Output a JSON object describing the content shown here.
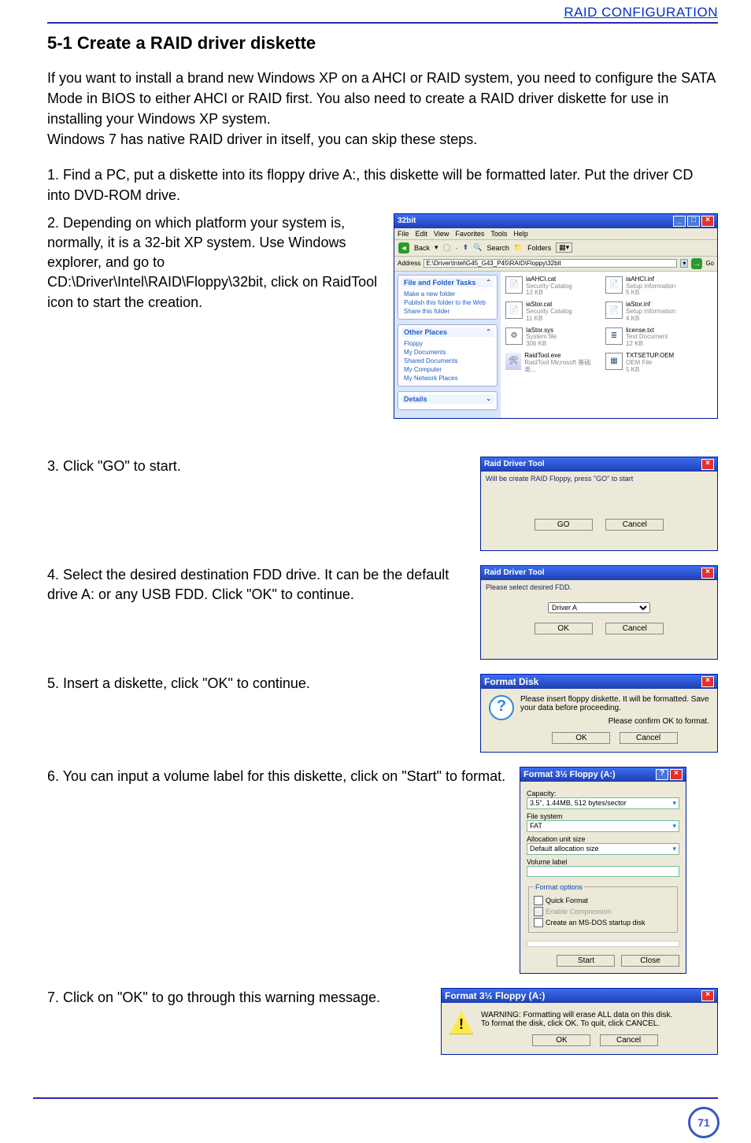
{
  "header": {
    "title": "RAID CONFIGURATION"
  },
  "section": {
    "title": "5-1 Create a RAID driver diskette"
  },
  "intro": {
    "p1": "If you want to install a brand new Windows XP on a AHCI or RAID system, you need to configure the SATA Mode in BIOS to either AHCI or RAID first. You also need to create a RAID driver diskette for use in installing your Windows XP system.",
    "p2": "Windows 7 has native RAID driver in itself, you can skip these steps."
  },
  "steps": {
    "s1": "1. Find a PC, put a diskette into its floppy drive A:, this diskette will be formatted later. Put the driver CD into DVD-ROM drive.",
    "s2": "2. Depending on which platform your system is, normally, it is a 32-bit XP system. Use Windows explorer, and go to CD:\\Driver\\Intel\\RAID\\Floppy\\32bit, click on RaidTool icon to start the creation.",
    "s3": "3. Click \"GO\" to start.",
    "s4": "4. Select the desired destination FDD drive.  It can be the default drive A: or any USB FDD. Click \"OK\" to continue.",
    "s5": "5. Insert a diskette, click \"OK\" to continue.",
    "s6": "6. You can input a volume label for this diskette, click    on \"Start\" to format.",
    "s7": "7. Click on \"OK\" to go through this warning message."
  },
  "explorer": {
    "title": "32bit",
    "menu": [
      "File",
      "Edit",
      "View",
      "Favorites",
      "Tools",
      "Help"
    ],
    "toolbar": {
      "back": "Back",
      "search": "Search",
      "folders": "Folders"
    },
    "address_label": "Address",
    "address": "E:\\Driver\\Intel\\G45_G43_P45\\RAID\\Floppy\\32bit",
    "go": "Go",
    "side": {
      "tasks": {
        "title": "File and Folder Tasks",
        "items": [
          "Make a new folder",
          "Publish this folder to the Web",
          "Share this folder"
        ]
      },
      "places": {
        "title": "Other Places",
        "items": [
          "Floppy",
          "My Documents",
          "Shared Documents",
          "My Computer",
          "My Network Places"
        ]
      },
      "details": {
        "title": "Details"
      }
    },
    "files": [
      {
        "name": "iaAHCI.cat",
        "type": "Security Catalog",
        "size": "12 KB"
      },
      {
        "name": "iaAHCI.inf",
        "type": "Setup Information",
        "size": "5 KB"
      },
      {
        "name": "iaStor.cat",
        "type": "Security Catalog",
        "size": "11 KB"
      },
      {
        "name": "iaStor.inf",
        "type": "Setup Information",
        "size": "4 KB"
      },
      {
        "name": "IaStor.sys",
        "type": "System file",
        "size": "306 KB"
      },
      {
        "name": "license.txt",
        "type": "Text Document",
        "size": "12 KB"
      },
      {
        "name": "RaidTool.exe",
        "type": "RaidTool Microsoft 基础类...",
        "size": ""
      },
      {
        "name": "TXTSETUP.OEM",
        "type": "OEM File",
        "size": "5 KB"
      }
    ]
  },
  "raidtool_go": {
    "title": "Raid Driver Tool",
    "msg": "Will be create RAID Floppy, press \"GO\" to start",
    "go": "GO",
    "cancel": "Cancel"
  },
  "raidtool_fdd": {
    "title": "Raid Driver Tool",
    "msg": "Please select desired FDD.",
    "option": "Driver A",
    "ok": "OK",
    "cancel": "Cancel"
  },
  "format_disk": {
    "title": "Format Disk",
    "line1": "Please insert floppy diskette.  It will be formatted. Save your data before proceeding.",
    "line2": "Please confirm OK to format.",
    "ok": "OK",
    "cancel": "Cancel"
  },
  "format_win": {
    "title": "Format 3½ Floppy (A:)",
    "capacity_label": "Capacity:",
    "capacity": "3.5\",  1.44MB, 512 bytes/sector",
    "fs_label": "File system",
    "fs": "FAT",
    "au_label": "Allocation unit size",
    "au": "Default allocation size",
    "vol_label": "Volume label",
    "vol": "",
    "options_legend": "Format options",
    "quick": "Quick Format",
    "enablec": "Enable Compression",
    "msdos": "Create an MS-DOS startup disk",
    "start": "Start",
    "close": "Close"
  },
  "format_warn": {
    "title": "Format 3½ Floppy (A:)",
    "msg": "WARNING: Formatting will erase ALL data on this disk.\nTo format the disk, click OK. To quit, click CANCEL.",
    "ok": "OK",
    "cancel": "Cancel"
  },
  "page_number": "71"
}
